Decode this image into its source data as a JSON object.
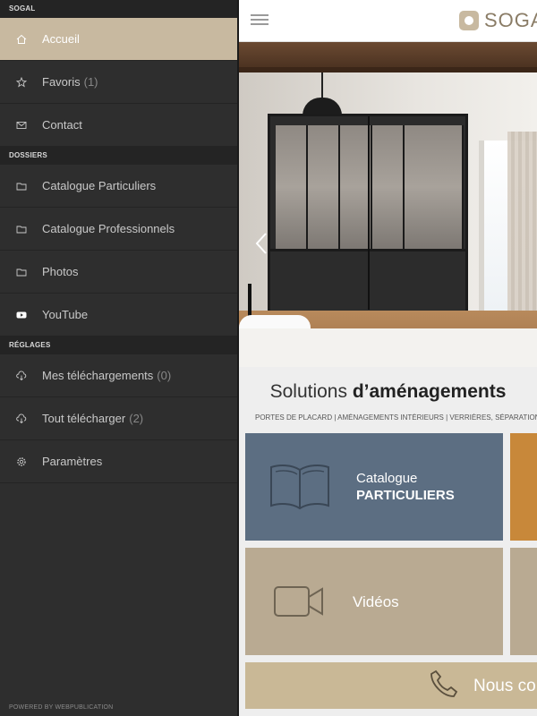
{
  "drawer": {
    "sections": [
      {
        "title": "SOGAL",
        "items": [
          {
            "label": "Accueil",
            "icon": "home-icon",
            "active": true
          },
          {
            "label": "Favoris",
            "count": "(1)",
            "icon": "star-icon"
          },
          {
            "label": "Contact",
            "icon": "mail-icon"
          }
        ]
      },
      {
        "title": "DOSSIERS",
        "items": [
          {
            "label": "Catalogue Particuliers",
            "icon": "folder-icon"
          },
          {
            "label": "Catalogue Professionnels",
            "icon": "folder-icon"
          },
          {
            "label": "Photos",
            "icon": "folder-icon"
          },
          {
            "label": "YouTube",
            "icon": "youtube-icon"
          }
        ]
      },
      {
        "title": "RÉGLAGES",
        "items": [
          {
            "label": "Mes téléchargements",
            "count": "(0)",
            "icon": "cloud-download-icon"
          },
          {
            "label": "Tout télécharger",
            "count": "(2)",
            "icon": "cloud-download-icon"
          },
          {
            "label": "Paramètres",
            "icon": "gear-icon"
          }
        ]
      }
    ],
    "powered_by": "POWERED BY WEBPUBLICATION"
  },
  "header": {
    "logo_text": "SOGAL"
  },
  "main": {
    "headline_normal": "Solutions ",
    "headline_bold": "d’aménagements",
    "subnav": "PORTES DE PLACARD  |  AMÉNAGEMENTS INTÉRIEURS  |  VERRIÈRES, SÉPARATIONS",
    "tiles": [
      {
        "line1": "Catalogue",
        "line2": "PARTICULIERS",
        "icon": "book-icon",
        "color": "#5c6e82"
      },
      {
        "line1": "Vidéos",
        "icon": "video-camera-icon",
        "color": "#b9aa92"
      },
      {
        "line1": "Nous con",
        "icon": "phone-icon",
        "color": "#c9b896"
      }
    ]
  },
  "colors": {
    "accent": "#c8b9a0",
    "drawer_bg": "#2e2e2e"
  }
}
